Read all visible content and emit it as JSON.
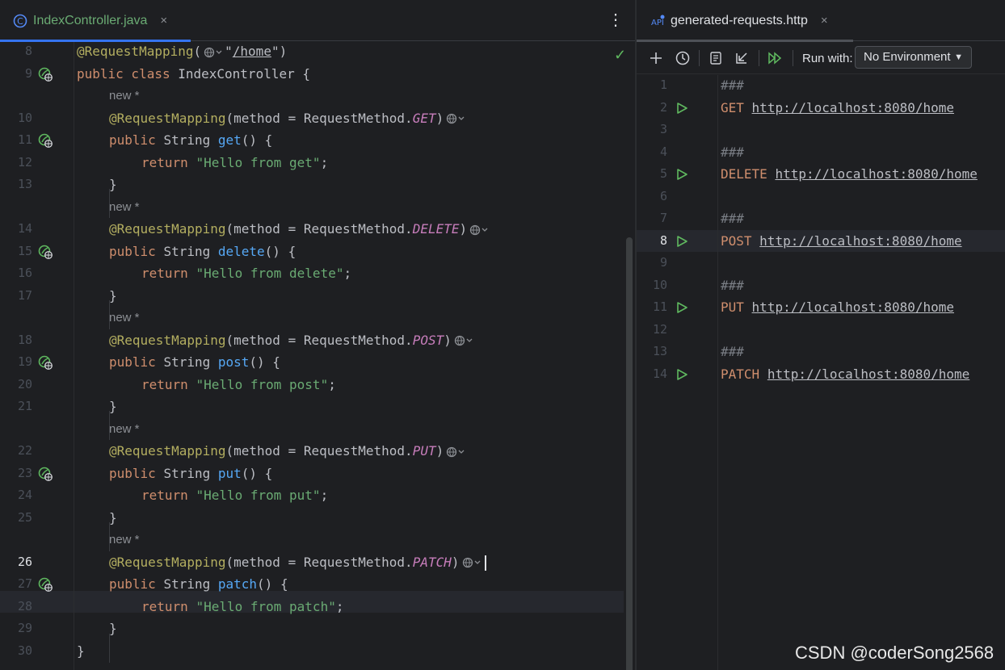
{
  "left_tab": {
    "icon": "class-icon",
    "label": "IndexController.java",
    "close": "×"
  },
  "menu": {
    "icon": "kebab-icon"
  },
  "editor": {
    "lines": [
      {
        "n": "8",
        "tokens": [
          [
            "ann",
            "@RequestMapping"
          ],
          [
            "",
            "("
          ],
          [
            "globe",
            ""
          ],
          [
            "",
            "\""
          ],
          [
            "url",
            "/home"
          ],
          [
            "",
            "\")"
          ]
        ]
      },
      {
        "n": "9",
        "tokens": [
          [
            "kw",
            "public class "
          ],
          [
            "",
            "IndexController {"
          ]
        ]
      },
      {
        "hint": "new *"
      },
      {
        "n": "10",
        "indent": 1,
        "tokens": [
          [
            "ann",
            "@RequestMapping"
          ],
          [
            "",
            "(method = RequestMethod."
          ],
          [
            "enum",
            "GET"
          ],
          [
            "",
            ")"
          ],
          [
            "globe",
            ""
          ]
        ]
      },
      {
        "n": "11",
        "indent": 1,
        "tokens": [
          [
            "kw",
            "public "
          ],
          [
            "",
            "String "
          ],
          [
            "fn",
            "get"
          ],
          [
            "",
            "() {"
          ]
        ]
      },
      {
        "n": "12",
        "indent": 2,
        "tokens": [
          [
            "kw",
            "return "
          ],
          [
            "str",
            "\"Hello from get\""
          ],
          [
            "",
            ";"
          ]
        ]
      },
      {
        "n": "13",
        "indent": 1,
        "tokens": [
          [
            "",
            "}"
          ]
        ]
      },
      {
        "hint": "new *"
      },
      {
        "n": "14",
        "indent": 1,
        "tokens": [
          [
            "ann",
            "@RequestMapping"
          ],
          [
            "",
            "(method = RequestMethod."
          ],
          [
            "enum",
            "DELETE"
          ],
          [
            "",
            ")"
          ],
          [
            "globe",
            ""
          ]
        ]
      },
      {
        "n": "15",
        "indent": 1,
        "tokens": [
          [
            "kw",
            "public "
          ],
          [
            "",
            "String "
          ],
          [
            "fn",
            "delete"
          ],
          [
            "",
            "() {"
          ]
        ]
      },
      {
        "n": "16",
        "indent": 2,
        "tokens": [
          [
            "kw",
            "return "
          ],
          [
            "str",
            "\"Hello from delete\""
          ],
          [
            "",
            ";"
          ]
        ]
      },
      {
        "n": "17",
        "indent": 1,
        "tokens": [
          [
            "",
            "}"
          ]
        ]
      },
      {
        "hint": "new *"
      },
      {
        "n": "18",
        "indent": 1,
        "tokens": [
          [
            "ann",
            "@RequestMapping"
          ],
          [
            "",
            "(method = RequestMethod."
          ],
          [
            "enum",
            "POST"
          ],
          [
            "",
            ")"
          ],
          [
            "globe",
            ""
          ]
        ]
      },
      {
        "n": "19",
        "indent": 1,
        "tokens": [
          [
            "kw",
            "public "
          ],
          [
            "",
            "String "
          ],
          [
            "fn",
            "post"
          ],
          [
            "",
            "() {"
          ]
        ]
      },
      {
        "n": "20",
        "indent": 2,
        "tokens": [
          [
            "kw",
            "return "
          ],
          [
            "str",
            "\"Hello from post\""
          ],
          [
            "",
            ";"
          ]
        ]
      },
      {
        "n": "21",
        "indent": 1,
        "tokens": [
          [
            "",
            "}"
          ]
        ]
      },
      {
        "hint": "new *"
      },
      {
        "n": "22",
        "indent": 1,
        "tokens": [
          [
            "ann",
            "@RequestMapping"
          ],
          [
            "",
            "(method = RequestMethod."
          ],
          [
            "enum",
            "PUT"
          ],
          [
            "",
            ")"
          ],
          [
            "globe",
            ""
          ]
        ]
      },
      {
        "n": "23",
        "indent": 1,
        "tokens": [
          [
            "kw",
            "public "
          ],
          [
            "",
            "String "
          ],
          [
            "fn",
            "put"
          ],
          [
            "",
            "() {"
          ]
        ]
      },
      {
        "n": "24",
        "indent": 2,
        "tokens": [
          [
            "kw",
            "return "
          ],
          [
            "str",
            "\"Hello from put\""
          ],
          [
            "",
            ";"
          ]
        ]
      },
      {
        "n": "25",
        "indent": 1,
        "tokens": [
          [
            "",
            "}"
          ]
        ]
      },
      {
        "hint": "new *"
      },
      {
        "n": "26",
        "indent": 1,
        "current": true,
        "tokens": [
          [
            "ann",
            "@RequestMapping"
          ],
          [
            "",
            "(method = RequestMethod."
          ],
          [
            "enum",
            "PATCH"
          ],
          [
            "",
            ")"
          ],
          [
            "globe",
            ""
          ]
        ]
      },
      {
        "n": "27",
        "indent": 1,
        "tokens": [
          [
            "kw",
            "public "
          ],
          [
            "",
            "String "
          ],
          [
            "fn",
            "patch"
          ],
          [
            "",
            "() {"
          ]
        ]
      },
      {
        "n": "28",
        "indent": 2,
        "tokens": [
          [
            "kw",
            "return "
          ],
          [
            "str",
            "\"Hello from patch\""
          ],
          [
            "",
            ";"
          ]
        ]
      },
      {
        "n": "29",
        "indent": 1,
        "tokens": [
          [
            "",
            "}"
          ]
        ]
      },
      {
        "n": "30",
        "tokens": [
          [
            "",
            "}"
          ]
        ]
      }
    ]
  },
  "right_tab": {
    "icon": "api-file-icon",
    "label": "generated-requests.http",
    "close": "×"
  },
  "toolbar": {
    "icons": [
      "add-icon",
      "history-icon",
      "examples-icon",
      "import-icon",
      "run-all-icon"
    ],
    "run_with_label": "Run with:",
    "environment": "No Environment"
  },
  "http": {
    "lines": [
      {
        "n": "1",
        "text": "###"
      },
      {
        "n": "2",
        "run": true,
        "method": "GET",
        "url": "http://localhost:8080/home"
      },
      {
        "n": "3",
        "text": ""
      },
      {
        "n": "4",
        "text": "###"
      },
      {
        "n": "5",
        "run": true,
        "method": "DELETE",
        "url": "http://localhost:8080/home"
      },
      {
        "n": "6",
        "text": ""
      },
      {
        "n": "7",
        "text": "###"
      },
      {
        "n": "8",
        "run": true,
        "method": "POST",
        "url": "http://localhost:8080/home",
        "current": true
      },
      {
        "n": "9",
        "text": ""
      },
      {
        "n": "10",
        "text": "###"
      },
      {
        "n": "11",
        "run": true,
        "method": "PUT",
        "url": "http://localhost:8080/home"
      },
      {
        "n": "12",
        "text": ""
      },
      {
        "n": "13",
        "text": "###"
      },
      {
        "n": "14",
        "run": true,
        "method": "PATCH",
        "url": "http://localhost:8080/home"
      }
    ]
  },
  "watermark": "CSDN @coderSong2568"
}
